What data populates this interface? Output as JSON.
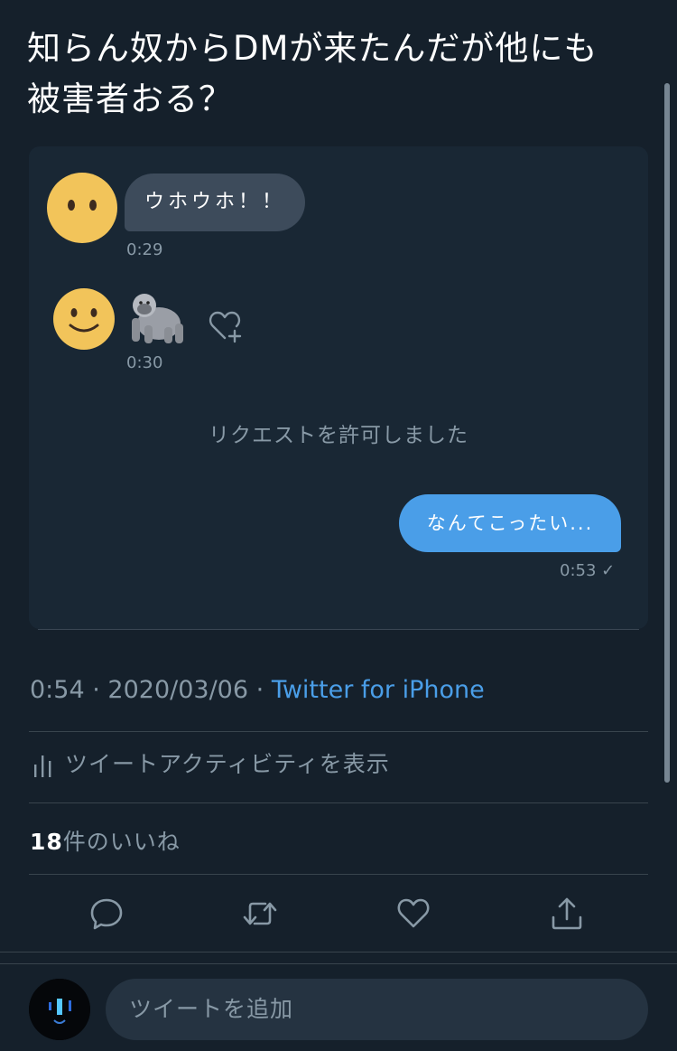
{
  "tweet": {
    "text_line1": "知らん奴からDMが来たんだが他にも",
    "text_line2": "被害者おる？"
  },
  "dm": {
    "incoming_message": "ウホウホ！！",
    "incoming_time": "0:29",
    "gorilla_emoji_time": "0:30",
    "system_note": "リクエストを許可しました",
    "outgoing_message": "なんてこったい...",
    "outgoing_time": "0:53 ✓"
  },
  "meta": {
    "time": "0:54",
    "dot": "·",
    "date": "2020/03/06",
    "source": "Twitter for iPhone"
  },
  "activity_label": "ツイートアクティビティを表示",
  "likes": {
    "count": "18",
    "label": "件のいいね"
  },
  "compose": {
    "placeholder": "ツイートを追加"
  },
  "colors": {
    "background": "#15202b",
    "accent": "#4a9ee8",
    "muted": "#8899a6"
  },
  "icons": [
    "reply-icon",
    "retweet-icon",
    "like-icon",
    "share-icon",
    "activity-bars-icon",
    "heart-plus-icon"
  ]
}
